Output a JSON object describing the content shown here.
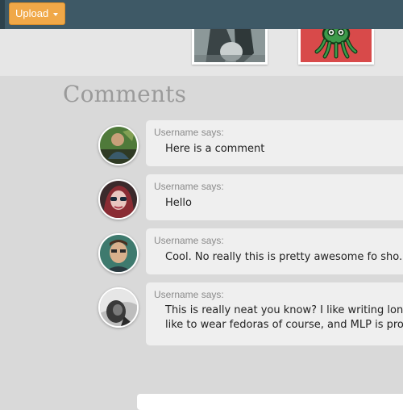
{
  "header": {
    "upload_label": "Upload"
  },
  "thumbnails": [
    {
      "name": "thumbnail-photo"
    },
    {
      "name": "thumbnail-octopus"
    }
  ],
  "section": {
    "title": "Comments"
  },
  "comments": [
    {
      "author": "Username says:",
      "text": "Here is a comment"
    },
    {
      "author": "Username says:",
      "text": "Hello"
    },
    {
      "author": "Username says:",
      "text": "Cool. No really this is pretty awesome fo sho."
    },
    {
      "author": "Username says:",
      "text_line1": "This is really neat you know? I like writing long",
      "text_line2": "like to wear fedoras of course, and MLP is prob"
    }
  ]
}
